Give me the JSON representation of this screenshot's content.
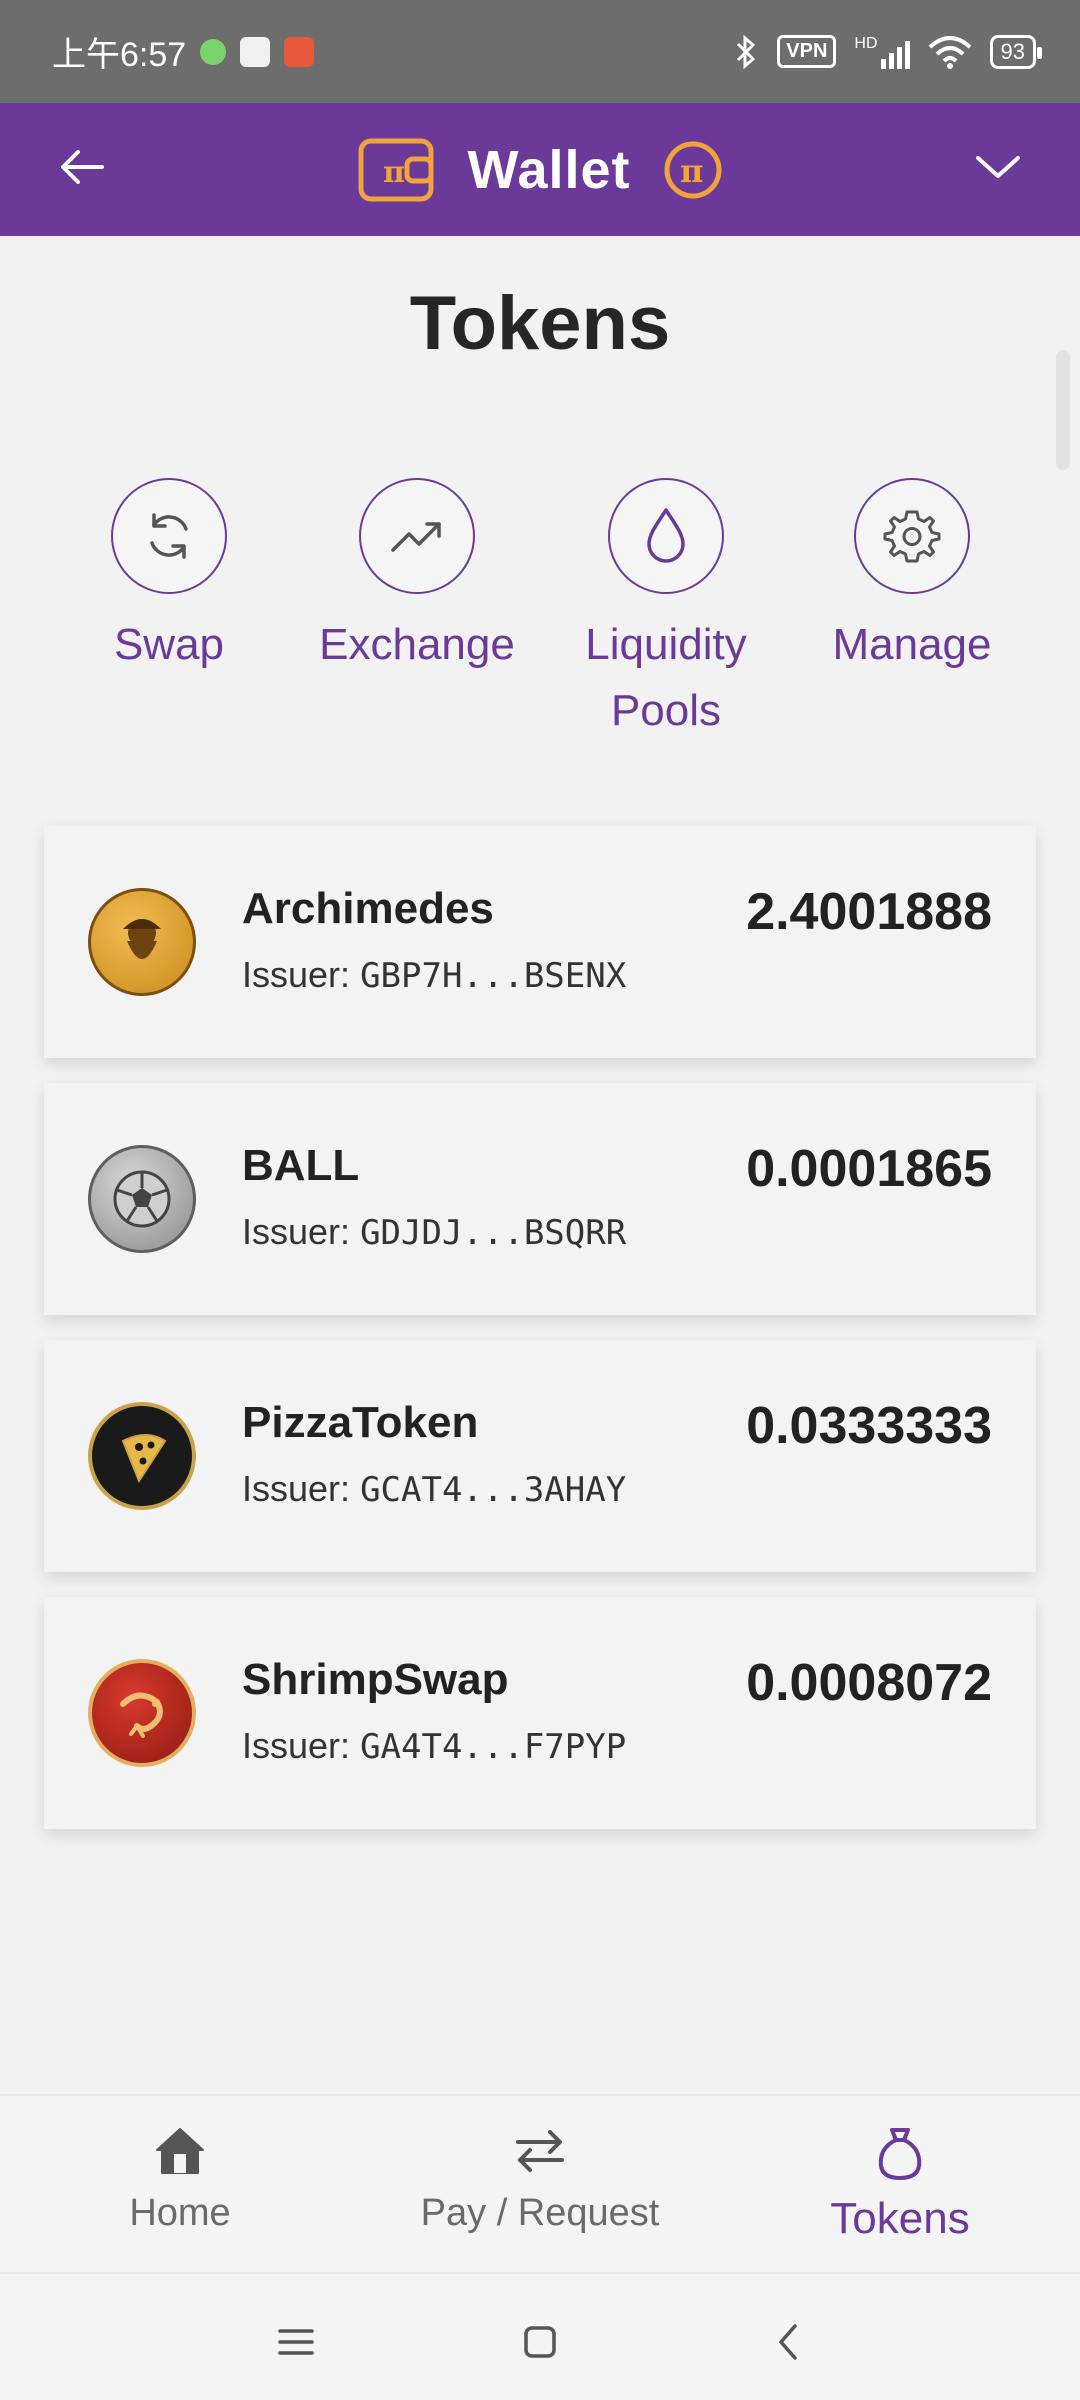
{
  "status_bar": {
    "time": "上午6:57",
    "vpn": "VPN",
    "hd": "HD",
    "battery": "93"
  },
  "header": {
    "title": "Wallet"
  },
  "page": {
    "title": "Tokens"
  },
  "actions": [
    {
      "label": "Swap",
      "icon": "refresh-icon"
    },
    {
      "label": "Exchange",
      "icon": "trending-up-icon"
    },
    {
      "label": "Liquidity Pools",
      "icon": "droplet-icon"
    },
    {
      "label": "Manage",
      "icon": "gear-icon"
    }
  ],
  "tokens": [
    {
      "name": "Archimedes",
      "issuer_prefix": "Issuer:",
      "issuer": "GBP7H...BSENX",
      "balance": "2.4001888",
      "color": "#e0a030"
    },
    {
      "name": "BALL",
      "issuer_prefix": "Issuer:",
      "issuer": "GDJDJ...BSQRR",
      "balance": "0.0001865",
      "color": "#9a9a9a"
    },
    {
      "name": "PizzaToken",
      "issuer_prefix": "Issuer:",
      "issuer": "GCAT4...3AHAY",
      "balance": "0.0333333",
      "color": "#1c1c1c"
    },
    {
      "name": "ShrimpSwap",
      "issuer_prefix": "Issuer:",
      "issuer": "GA4T4...F7PYP",
      "balance": "0.0008072",
      "color": "#b8241c"
    }
  ],
  "bottom_nav": [
    {
      "label": "Home",
      "icon": "home-icon"
    },
    {
      "label": "Pay / Request",
      "icon": "transfer-icon"
    },
    {
      "label": "Tokens",
      "icon": "bag-icon",
      "active": true
    }
  ],
  "colors": {
    "brand_purple": "#6b3a99",
    "accent_gold": "#f2a33a"
  }
}
